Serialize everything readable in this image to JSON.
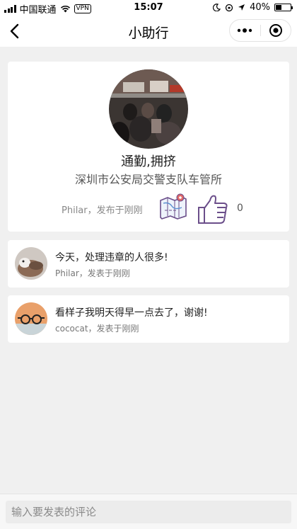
{
  "status_bar": {
    "carrier": "中国联通",
    "vpn": "VPN",
    "time": "15:07",
    "battery": "40%",
    "battery_level": 0.4
  },
  "nav": {
    "title": "小助行"
  },
  "post": {
    "title": "通勤,拥挤",
    "location": "深圳市公安局交警支队车管所",
    "meta": "Philar，发布于刚刚",
    "like_count": "0",
    "icons": {
      "map": "map-icon",
      "like": "thumbs-up-icon",
      "avatar": "avatar-photo"
    }
  },
  "comments": [
    {
      "text": "今天，处理违章的人很多!",
      "meta": "Philar，发表于刚刚"
    },
    {
      "text": "看样子我明天得早一点去了，谢谢!",
      "meta": "cococat，发表于刚刚"
    }
  ],
  "input": {
    "placeholder": "输入要发表的评论"
  },
  "colors": {
    "background": "#f0f0f0",
    "card": "#ffffff",
    "icon_purple": "#6b4e8a"
  }
}
